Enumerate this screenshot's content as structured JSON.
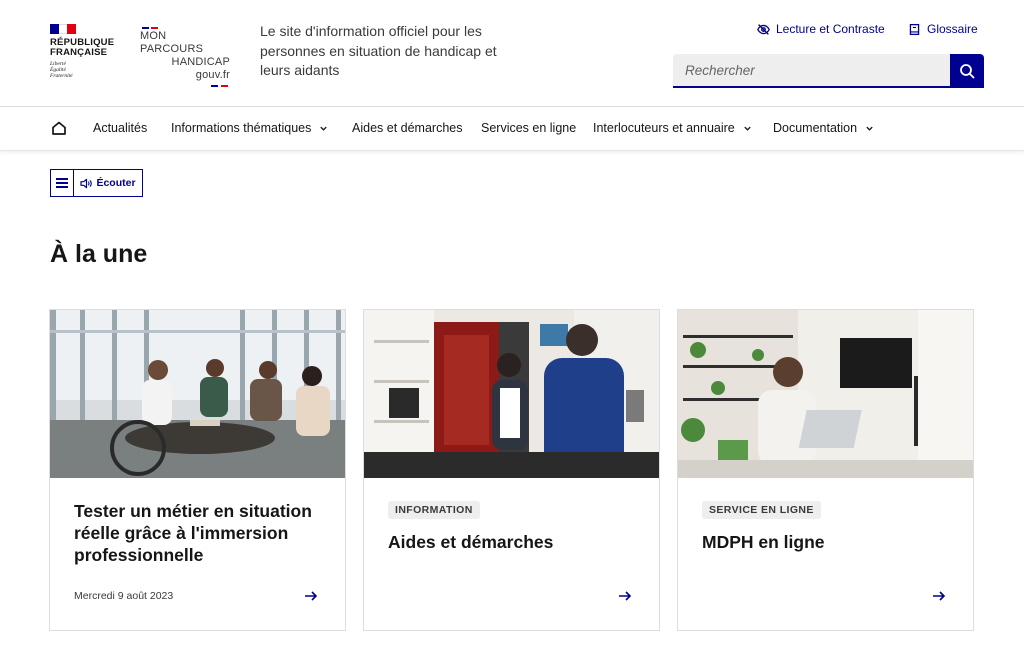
{
  "header": {
    "republique_lines": [
      "RÉPUBLIQUE",
      "FRANÇAISE"
    ],
    "devise_lines": [
      "Liberté",
      "Égalité",
      "Fraternité"
    ],
    "site_logo_lines": [
      "MON PARCOURS",
      "HANDICAP",
      "gouv.fr"
    ],
    "tagline": "Le site d'information officiel pour les personnes en situation de handicap et leurs aidants",
    "tools": {
      "contrast_label": "Lecture et Contraste",
      "glossary_label": "Glossaire"
    },
    "search": {
      "placeholder": "Rechercher"
    }
  },
  "nav": {
    "home_icon": "home-icon",
    "items": [
      {
        "label": "Actualités",
        "has_dropdown": false
      },
      {
        "label": "Informations thématiques",
        "has_dropdown": true
      },
      {
        "label": "Aides et démarches",
        "has_dropdown": false
      },
      {
        "label": "Services en ligne",
        "has_dropdown": false
      },
      {
        "label": "Interlocuteurs et annuaire",
        "has_dropdown": true
      },
      {
        "label": "Documentation",
        "has_dropdown": true
      }
    ]
  },
  "listen_widget": {
    "label": "Écouter"
  },
  "section": {
    "title": "À la une"
  },
  "cards": [
    {
      "badge": "",
      "title": "Tester un métier en situation réelle grâce à l'immersion professionnelle",
      "date": "Mercredi 9 août 2023"
    },
    {
      "badge": "INFORMATION",
      "title": "Aides et démarches",
      "date": ""
    },
    {
      "badge": "SERVICE EN LIGNE",
      "title": "MDPH en ligne",
      "date": ""
    }
  ],
  "colors": {
    "primary": "#000091",
    "flag_blue": "#000091",
    "flag_white": "#ffffff",
    "flag_red": "#e1000f",
    "text": "#161616",
    "badge_bg": "#eeeeee"
  }
}
